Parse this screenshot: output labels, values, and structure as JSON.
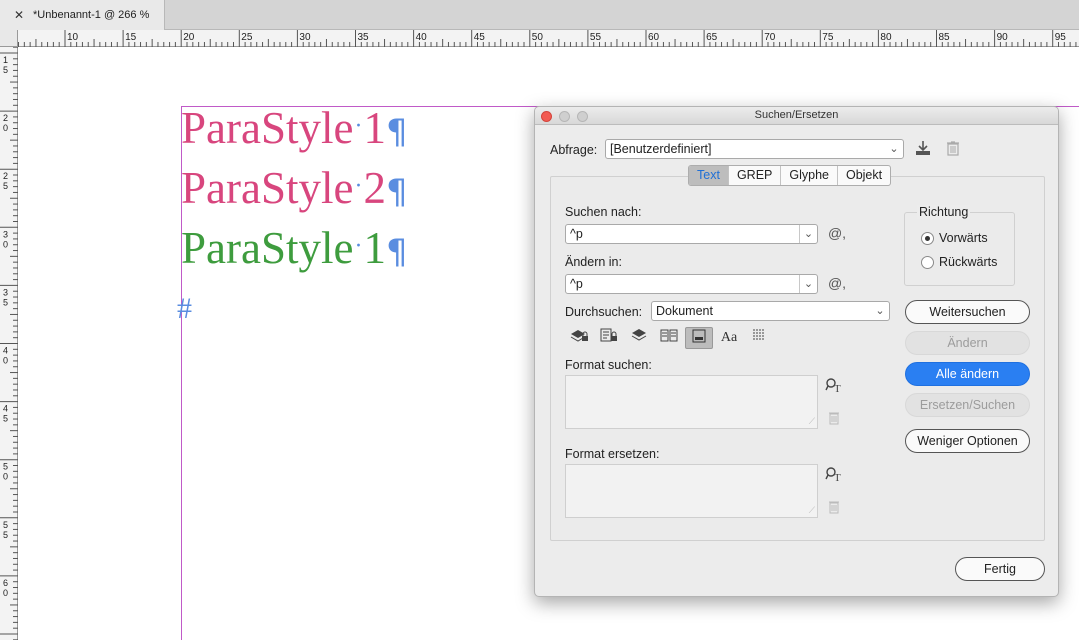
{
  "tab": {
    "close": "✕",
    "title": "*Unbenannt-1 @ 266 %"
  },
  "ruler": {
    "h_labels": [
      "10",
      "15",
      "20",
      "25",
      "30",
      "35",
      "40",
      "45",
      "50",
      "55",
      "60",
      "65",
      "70",
      "75",
      "80",
      "85",
      "90",
      "95"
    ],
    "v_labels": [
      "1\n5",
      "2\n0",
      "2\n5",
      "3\n0",
      "3\n5",
      "4\n0",
      "4\n5",
      "5\n0",
      "5\n5",
      "6\n0"
    ]
  },
  "document": {
    "lines": [
      {
        "word": "ParaStyle",
        "num": "1",
        "color": "pink"
      },
      {
        "word": "ParaStyle",
        "num": "2",
        "color": "pink"
      },
      {
        "word": "ParaStyle",
        "num": "1",
        "color": "green"
      }
    ],
    "dot": "·",
    "pilcrow": "¶",
    "end_marker": "#"
  },
  "dialog": {
    "title": "Suchen/Ersetzen",
    "query_label": "Abfrage:",
    "query_value": "[Benutzerdefiniert]",
    "tabs": [
      "Text",
      "GREP",
      "Glyphe",
      "Objekt"
    ],
    "active_tab": "Text",
    "find_label": "Suchen nach:",
    "find_value": "^p",
    "change_label": "Ändern in:",
    "change_value": "^p",
    "search_label": "Durchsuchen:",
    "search_value": "Dokument",
    "format_find_label": "Format suchen:",
    "format_change_label": "Format ersetzen:",
    "direction_label": "Richtung",
    "forward_label": "Vorwärts",
    "backward_label": "Rückwärts",
    "btn_find_next": "Weitersuchen",
    "btn_change": "Ändern",
    "btn_change_all": "Alle ändern",
    "btn_change_find": "Ersetzen/Suchen",
    "btn_fewer": "Weniger Optionen",
    "btn_done": "Fertig",
    "case_icon_label": "Aa"
  },
  "colors": {
    "pink": "#d8467e",
    "green": "#3e9c3e",
    "accent": "#2a7ff2",
    "margin_guide": "#c05ac8"
  }
}
